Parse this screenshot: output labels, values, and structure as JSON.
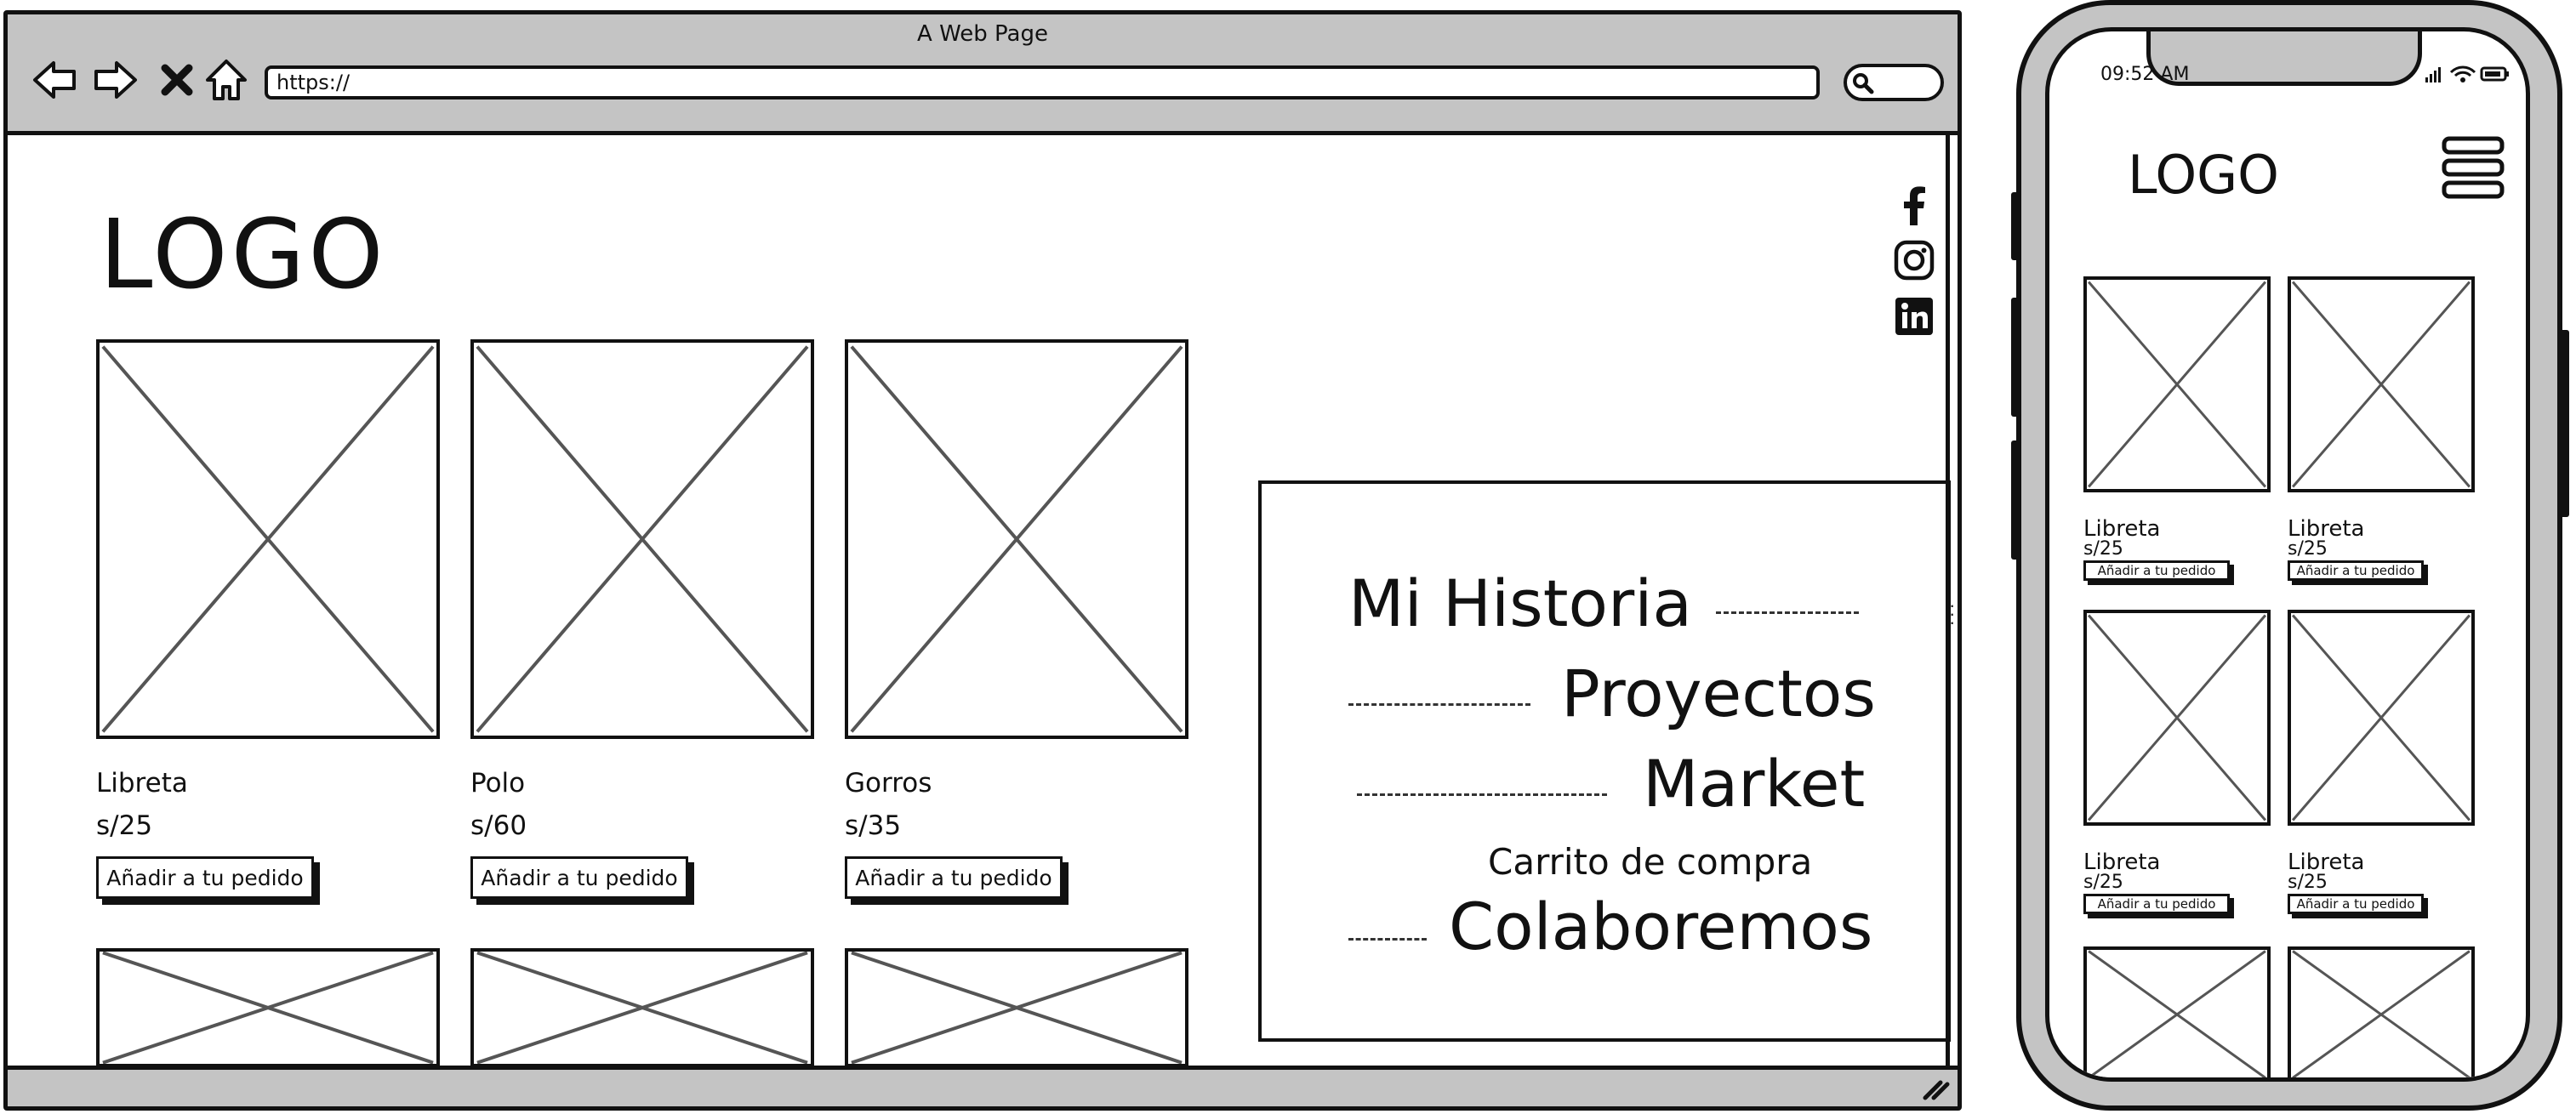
{
  "browser": {
    "title": "A Web Page",
    "url": "https://",
    "nav_icons": [
      "back-arrow-icon",
      "forward-arrow-icon",
      "close-x-icon",
      "home-icon"
    ],
    "search_icon": "search-icon"
  },
  "site": {
    "logo": "LOGO",
    "social_icons": [
      "facebook-icon",
      "instagram-icon",
      "linkedin-icon"
    ],
    "products": [
      {
        "name": "Libreta",
        "price": "s/25",
        "button": "Añadir a tu pedido"
      },
      {
        "name": "Polo",
        "price": "s/60",
        "button": "Añadir a tu pedido"
      },
      {
        "name": "Gorros",
        "price": "s/35",
        "button": "Añadir a tu pedido"
      }
    ],
    "menu": {
      "historia": "Mi Historia",
      "proyectos": "Proyectos",
      "market": "Market",
      "carrito": "Carrito de compra",
      "colaboremos": "Colaboremos"
    }
  },
  "phone": {
    "time": "09:52 AM",
    "logo": "LOGO",
    "menu_icon": "hamburger-menu-icon",
    "products": [
      {
        "name": "Libreta",
        "price": "s/25",
        "button": "Añadir a tu pedido"
      },
      {
        "name": "Libreta",
        "price": "s/25",
        "button": "Añadir a tu pedido"
      },
      {
        "name": "Libreta",
        "price": "s/25",
        "button": "Añadir a tu pedido"
      },
      {
        "name": "Libreta",
        "price": "s/25",
        "button": "Añadir a tu pedido"
      }
    ]
  },
  "colors": {
    "chrome_gray": "#c4c4c4",
    "outline": "#111111",
    "placeholder_x": "#555555"
  }
}
